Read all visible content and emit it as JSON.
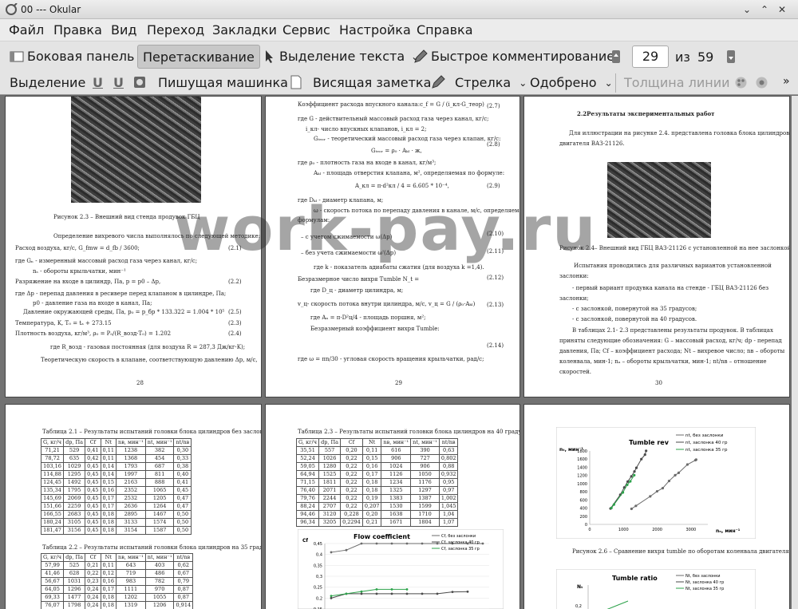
{
  "window": {
    "title": "00 --- Okular"
  },
  "menu": [
    "Файл",
    "Правка",
    "Вид",
    "Переход",
    "Закладки",
    "Сервис",
    "Настройка",
    "Справка"
  ],
  "toolbar1": {
    "sidebar": "Боковая панель",
    "drag": "Перетаскивание",
    "text_select": "Выделение текста",
    "quick_comment": "Быстрое комментирование",
    "page": "29",
    "of": "из",
    "total": "59"
  },
  "toolbar2": {
    "select": "Выделение",
    "typewriter": "Пишущая машинка",
    "sticky": "Висящая заметка",
    "arrow": "Стрелка",
    "approved": "Одобрено",
    "line_width": "Толщина линии"
  },
  "p28": {
    "caption": "Рисунок 2.3 – Внешний вид стенда продувок ГБЦ",
    "lines": [
      "Определение вихревого числа выполнялось по следующей методике:",
      "Расход воздуха, кг/с, G_fmw = d_fb / 3600;",
      "где Gₙ - измеренный массовый расход газа через канал, кг/с;",
      "nₛ - обороты крыльчатки, мин⁻¹",
      "Разряжение на входе в цилиндр, Па, p = p0 – Δp,",
      "где Δp - перепад давления в ресивере перед клапаном в цилиндре, Па;",
      "p0 - давление газа на входе в канал, Па;",
      "Давление окружающей среды, Па, p₀ = p_бр * 133.322 = 1.004 * 10⁵",
      "Температура, K, T₀ = tₐ + 273.15",
      "Плотность воздуха, кг/м³, ρ₀ = P₀/(R_возд·T₀) = 1.202",
      "где R_возд - газовая постоянная (для воздуха R = 287,3 Дж/кг·K);",
      "Теоретическую скорость в клапане, соответствующую давлению Δp, м/с,"
    ],
    "nums": [
      "(2.1)",
      "(2.2)",
      "(2.3)",
      "(2.4)",
      "(2.5)"
    ],
    "page_no": "28"
  },
  "p29": {
    "lines": [
      "Коэффициент расхода впускного канала:c_f = G / (i_кл·G_теор)",
      "где G - действительный массовый расход газа через канал, кг/с;",
      "i_кл- число впускных клапанов, i_кл = 2;",
      "Gₜₑₒᵣ - теоретический массовый расход газа через клапан, кг/с:",
      "Gₜₑₒᵣ = ρ₀ · Aₖₗ · ж,",
      "где ρ₀ - плотность газа на входе в канал, кг/м³;",
      "Aₖₗ - площадь отверстия клапана, м², определяемая по формуле:",
      "A_кл = π·d²кл / 4 = 6.605 * 10⁻⁴,",
      "где Dₖₗ - диаметр клапана, м;",
      "ω - скорость потока по перепаду давления в канале, м/с, определяемая по",
      "формулам:",
      "– с учетом сжимаемости ω(Δp)",
      "– без учета сжимаемости ω'(Δp)",
      "где k - показатель адиабаты сжатия (для воздуха k =1,4).",
      "Безразмерное число вихря Tumble N_t =",
      "где D_ц - диаметр цилиндра, м;",
      "v_ц- скорость потока внутри цилиндра, м/с, v_ц = G / (ρ₀·Aₖₗ)",
      "где Aₙ = π·D²ц/4 - площадь поршня, м²;",
      "Безразмерный коэффициент вихря Tumble:",
      "где ω = πn/30 - угловая скорость вращения крыльчатки, рад/с;"
    ],
    "nums": [
      "(2.7)",
      "(2.8)",
      "(2.9)",
      "(2.10)",
      "(2.11)",
      "(2.12)",
      "(2.13)",
      "(2.14)"
    ],
    "page_no": "29"
  },
  "p30": {
    "heading": "2.2Результаты экспериментальных работ",
    "intro": [
      "Для иллюстрации на рисунке 2.4. представлена головка блока цилиндров",
      "двигателя ВАЗ-21126."
    ],
    "caption": "Рисунок 2.4– Внешний вид ГБЦ ВАЗ-21126 с установленной на нее заслонкой",
    "body": [
      "Испытания проводились для различных вариантов установленной",
      "заслонки:",
      "- первый вариант продувка канала на стенде - ГБЦ ВАЗ-21126 без",
      "заслонки;",
      "- с заслонкой, повернутой на 35 градусов;",
      "- с заслонкой, повернутой на 40 градусов.",
      "В таблицах 2.1- 2.3 представлены результаты продувок. В таблицах",
      "приняты следующие обозначения: G – массовый расход, кг/ч; dp - перепад",
      "давления, Па; Cf – коэффициент расхода; Nt – вихревое число; nв – обороты",
      "коленвала, мин-1; nₐ – обороты крыльчатки, мин-1; nt/nв – отношение",
      "скоростей."
    ],
    "page_no": "30"
  },
  "p31": {
    "t21_caption": "Таблица 2.1 – Результаты испытаний головки блока цилиндров без заслонки",
    "t21_head": [
      "G, кг/ч",
      "dp, Па",
      "Cf",
      "Nt",
      "nв, мин⁻¹",
      "nt, мин⁻¹",
      "nt/nв"
    ],
    "t21": [
      [
        "71,21",
        "529",
        "0,41",
        "0,11",
        "1238",
        "382",
        "0,30"
      ],
      [
        "78,72",
        "635",
        "0,42",
        "0,11",
        "1368",
        "454",
        "0,33"
      ],
      [
        "103,16",
        "1029",
        "0,45",
        "0,14",
        "1793",
        "687",
        "0,38"
      ],
      [
        "114,88",
        "1295",
        "0,45",
        "0,14",
        "1997",
        "811",
        "0,40"
      ],
      [
        "124,45",
        "1492",
        "0,45",
        "0,15",
        "2163",
        "888",
        "0,41"
      ],
      [
        "135,34",
        "1795",
        "0,45",
        "0,16",
        "2352",
        "1065",
        "0,45"
      ],
      [
        "145,69",
        "2069",
        "0,45",
        "0,17",
        "2532",
        "1205",
        "0,47"
      ],
      [
        "151,66",
        "2259",
        "0,45",
        "0,17",
        "2636",
        "1264",
        "0,47"
      ],
      [
        "166,55",
        "2683",
        "0,45",
        "0,18",
        "2895",
        "1467",
        "0,50"
      ],
      [
        "180,24",
        "3105",
        "0,45",
        "0,18",
        "3133",
        "1574",
        "0,50"
      ],
      [
        "181,47",
        "3156",
        "0,45",
        "0,18",
        "3154",
        "1587",
        "0,50"
      ]
    ],
    "t22_caption": "Таблица 2.2 – Результаты испытаний головки блока цилиндров на 35 градусов",
    "t22": [
      [
        "57,99",
        "525",
        "0,21",
        "0,11",
        "643",
        "403",
        "0,62"
      ],
      [
        "41,46",
        "628",
        "0,22",
        "0,12",
        "719",
        "486",
        "0,67"
      ],
      [
        "56,67",
        "1031",
        "0,23",
        "0,16",
        "983",
        "782",
        "0,79"
      ],
      [
        "64,05",
        "1296",
        "0,24",
        "0,17",
        "1111",
        "970",
        "0,87"
      ],
      [
        "69,33",
        "1477",
        "0,24",
        "0,18",
        "1202",
        "1055",
        "0,87"
      ],
      [
        "76,07",
        "1798",
        "0,24",
        "0,18",
        "1319",
        "1206",
        "0,914"
      ]
    ]
  },
  "p32": {
    "t23_caption": "Таблица 2.3 – Результаты испытаний головки блока цилиндров на 40 градусов",
    "t23": [
      [
        "35,51",
        "557",
        "0,20",
        "0,11",
        "616",
        "390",
        "0,63"
      ],
      [
        "52,24",
        "1026",
        "0,22",
        "0,15",
        "906",
        "727",
        "0,802"
      ],
      [
        "59,05",
        "1280",
        "0,22",
        "0,16",
        "1024",
        "906",
        "0,88"
      ],
      [
        "64,94",
        "1525",
        "0,22",
        "0,17",
        "1126",
        "1050",
        "0,932"
      ],
      [
        "71,15",
        "1811",
        "0,22",
        "0,18",
        "1234",
        "1176",
        "0,95"
      ],
      [
        "76,40",
        "2071",
        "0,22",
        "0,18",
        "1325",
        "1297",
        "0,97"
      ],
      [
        "79,76",
        "2244",
        "0,22",
        "0,19",
        "1383",
        "1387",
        "1,002"
      ],
      [
        "88,24",
        "2707",
        "0,22",
        "0,207",
        "1530",
        "1599",
        "1,045"
      ],
      [
        "94,46",
        "3120",
        "0,228",
        "0,20",
        "1638",
        "1710",
        "1,04"
      ],
      [
        "96,34",
        "3205",
        "0,2294",
        "0,21",
        "1671",
        "1804",
        "1,07"
      ]
    ],
    "chart_title": "Flow coefficient",
    "y_axis": "Cf",
    "y_ticks": [
      "0,45",
      "0,4",
      "0,35",
      "0,3",
      "0,25",
      "0,2",
      "0,15"
    ],
    "legend": [
      "Cf, без заслонки",
      "Cf, заслонка 40 гр",
      "Cf, заслонка 35 гр"
    ]
  },
  "p33": {
    "chart_title": "Tumble rev",
    "y_axis": "nₜ, мин⁻¹",
    "x_axis": "nₙ, мин⁻¹",
    "y_ticks": [
      "1800",
      "1600",
      "1400",
      "1200",
      "1000",
      "800",
      "600",
      "400",
      "200",
      "0"
    ],
    "x_ticks": [
      "0",
      "1000",
      "2000",
      "3000"
    ],
    "legend": [
      "nt, без заслонки",
      "nt, заслонка 40 гр",
      "nt, заслонка 35 гр"
    ],
    "caption": "Рисунок 2.6 – Сравнение вихря tumble по оборотам коленвала двигателя",
    "chart2_title": "Tumble ratio",
    "chart2_y": "Nₜ",
    "chart2_legend": [
      "Nt, без заслонки",
      "Nt, заслонка 40 гр",
      "Nt, заслонка 35 гр"
    ],
    "chart2_tick": "0,2"
  },
  "watermark": "work-pay.ru",
  "chart_data": [
    {
      "type": "line",
      "title": "Tumble rev",
      "xlabel": "nₙ, мин⁻¹",
      "ylabel": "nₜ, мин⁻¹",
      "xlim": [
        0,
        3500
      ],
      "ylim": [
        0,
        1800
      ],
      "series": [
        {
          "name": "nt, без заслонки",
          "x": [
            1238,
            1368,
            1793,
            1997,
            2163,
            2352,
            2532,
            2636,
            2895,
            3133,
            3154
          ],
          "y": [
            382,
            454,
            687,
            811,
            888,
            1065,
            1205,
            1264,
            1467,
            1574,
            1587
          ],
          "color": "#6b6b6b"
        },
        {
          "name": "nt, заслонка 40 гр",
          "x": [
            616,
            906,
            1024,
            1126,
            1234,
            1325,
            1383,
            1530,
            1638,
            1671
          ],
          "y": [
            390,
            727,
            906,
            1050,
            1176,
            1297,
            1387,
            1599,
            1710,
            1804
          ],
          "color": "#4a4a4a"
        },
        {
          "name": "nt, заслонка 35 гр",
          "x": [
            643,
            719,
            983,
            1111,
            1202,
            1319
          ],
          "y": [
            403,
            486,
            782,
            970,
            1055,
            1206
          ],
          "color": "#2ca24a"
        }
      ]
    },
    {
      "type": "line",
      "title": "Flow coefficient",
      "ylabel": "Cf",
      "ylim": [
        0.15,
        0.45
      ],
      "series": [
        {
          "name": "Cf, без заслонки",
          "y": [
            0.41,
            0.42,
            0.45,
            0.45,
            0.45,
            0.45,
            0.45,
            0.45,
            0.45,
            0.45,
            0.45
          ],
          "color": "#6b6b6b"
        },
        {
          "name": "Cf, заслонка 40 гр",
          "y": [
            0.2,
            0.22,
            0.22,
            0.22,
            0.22,
            0.22,
            0.22,
            0.22,
            0.228,
            0.2294
          ],
          "color": "#4a4a4a"
        },
        {
          "name": "Cf, заслонка 35 гр",
          "y": [
            0.21,
            0.22,
            0.23,
            0.24,
            0.24,
            0.24
          ],
          "color": "#2ca24a"
        }
      ]
    }
  ]
}
